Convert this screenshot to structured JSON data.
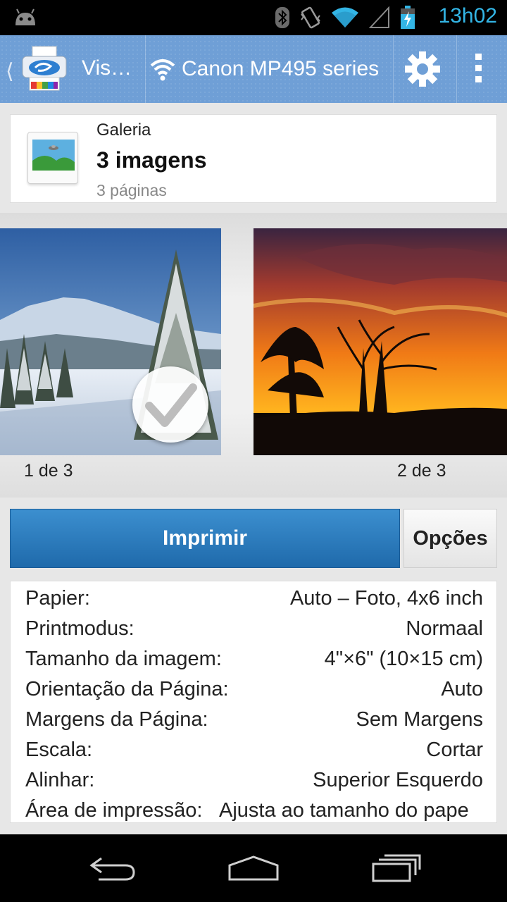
{
  "status_bar": {
    "time": "13h02",
    "icons": [
      "android-icon",
      "bluetooth-icon",
      "vibrate-icon",
      "wifi-icon",
      "signal-icon",
      "battery-charging-icon"
    ]
  },
  "action_bar": {
    "app_title": "Vis…",
    "printer_name": "Canon MP495 series",
    "icons": [
      "printer-logo-icon",
      "wifi-icon",
      "gear-icon",
      "overflow-menu-icon"
    ]
  },
  "source": {
    "name": "Galeria",
    "count": "3 imagens",
    "pages": "3 páginas"
  },
  "thumbnails": [
    {
      "label": "1 de 3",
      "selected": true
    },
    {
      "label": "2 de 3",
      "selected": false
    }
  ],
  "buttons": {
    "print": "Imprimir",
    "options": "Opções"
  },
  "settings": [
    {
      "key": "Papier:",
      "value": "Auto – Foto, 4x6 inch"
    },
    {
      "key": "Printmodus:",
      "value": "Normaal"
    },
    {
      "key": "Tamanho da imagem:",
      "value": "4\"×6\" (10×15 cm)"
    },
    {
      "key": "Orientação da Página:",
      "value": "Auto"
    },
    {
      "key": "Margens da Página:",
      "value": "Sem Margens"
    },
    {
      "key": "Escala:",
      "value": "Cortar"
    },
    {
      "key": "Alinhar:",
      "value": "Superior Esquerdo"
    },
    {
      "key": "Área de impressão:",
      "value": "Ajusta ao tamanho do pape"
    }
  ],
  "nav_bar": {
    "icons": [
      "back-icon",
      "home-icon",
      "recent-apps-icon"
    ]
  }
}
